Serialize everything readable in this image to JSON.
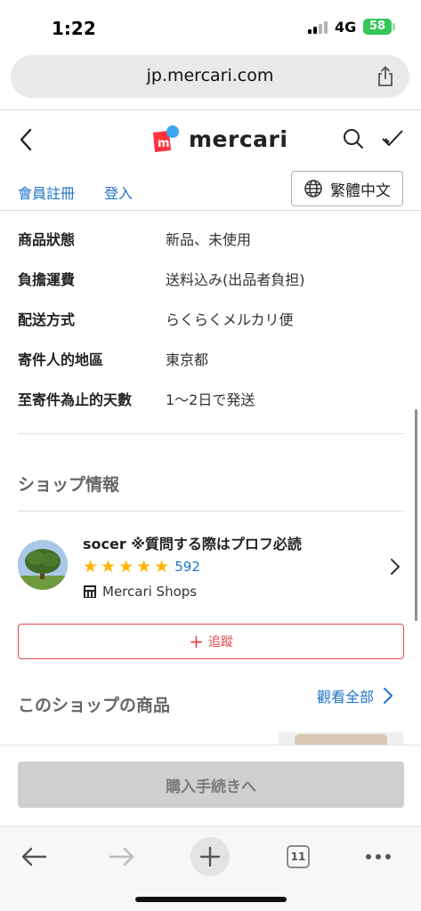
{
  "status_bar": {
    "time": "1:22",
    "network": "4G",
    "battery": "58"
  },
  "browser": {
    "url": "jp.mercari.com",
    "tab_count": "11"
  },
  "header": {
    "logo_text": "mercari"
  },
  "auth": {
    "register": "會員註冊",
    "login": "登入",
    "language": "繁體中文"
  },
  "details": [
    {
      "label": "商品狀態",
      "value": "新品、未使用"
    },
    {
      "label": "負擔運費",
      "value": "送料込み(出品者負担)"
    },
    {
      "label": "配送方式",
      "value": "らくらくメルカリ便"
    },
    {
      "label": "寄件人的地區",
      "value": "東京都"
    },
    {
      "label": "至寄件為止的天數",
      "value": "1〜2日で発送"
    }
  ],
  "shop": {
    "section_title": "ショップ情報",
    "name": "socer ※質問する際はプロフ必読",
    "rating_stars": 5,
    "rating_count": "592",
    "shops_label": "Mercari Shops",
    "follow_label": "追蹤"
  },
  "shop_products": {
    "title": "このショップの商品",
    "view_all": "觀看全部"
  },
  "buy": {
    "label": "購入手続きへ"
  },
  "colors": {
    "mercari_red": "#ff333f",
    "link_blue": "#1e73c8",
    "star": "#ffb400"
  }
}
